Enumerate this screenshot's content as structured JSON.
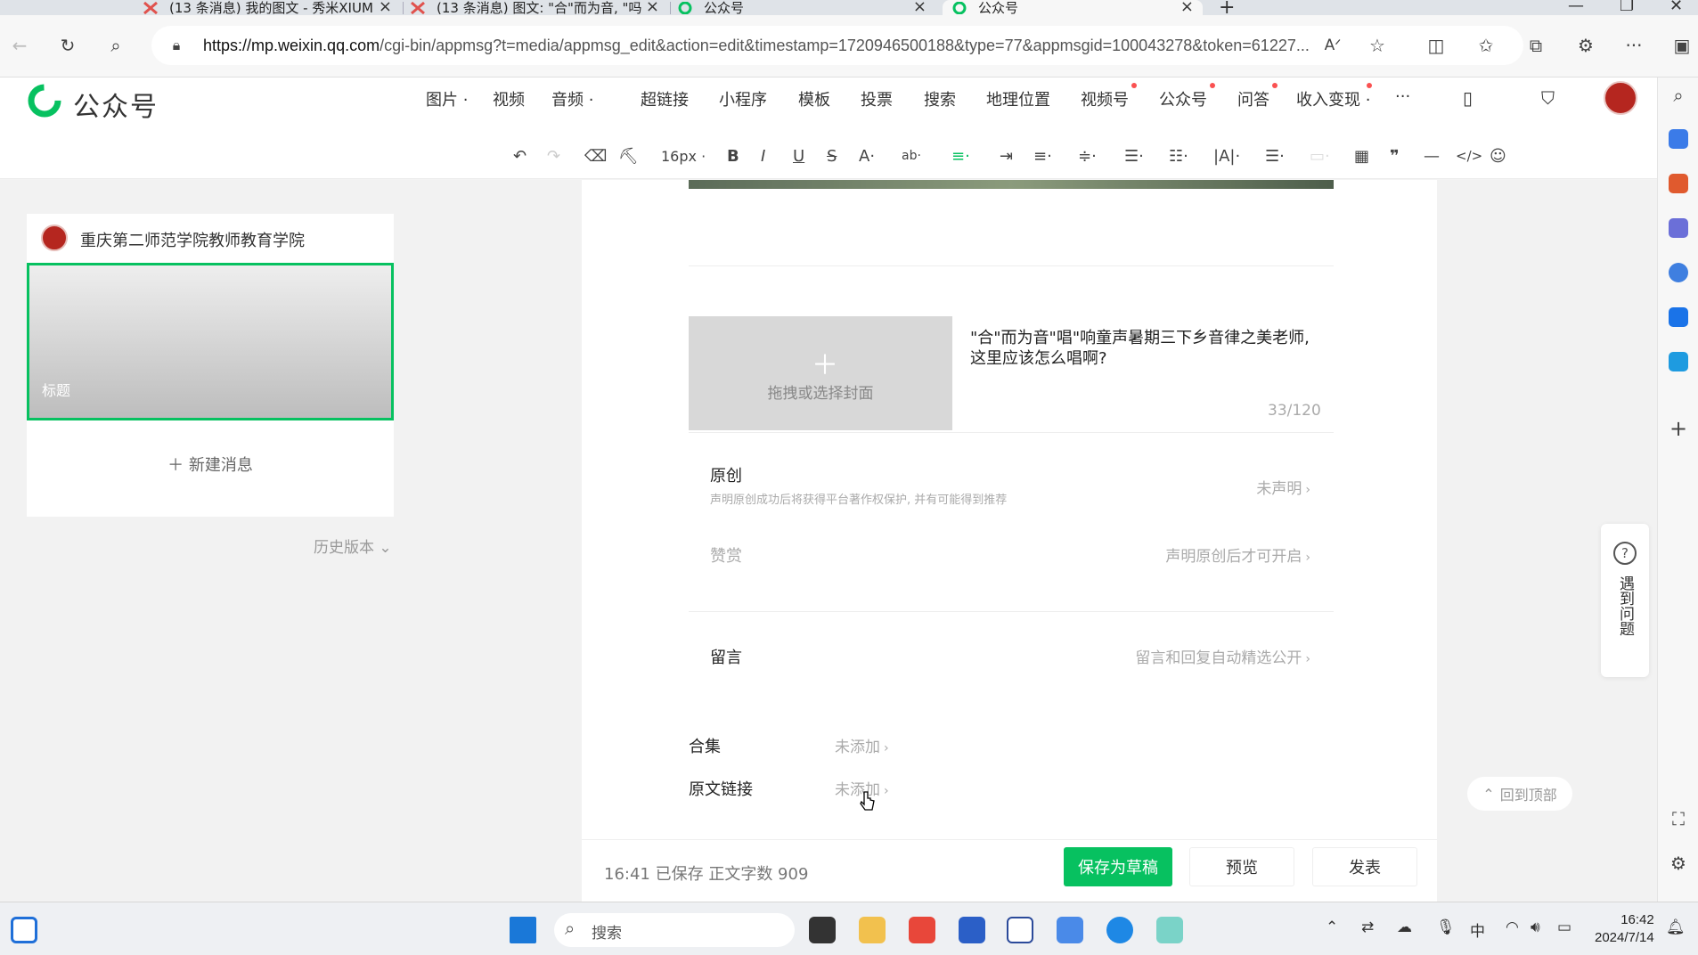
{
  "browser": {
    "tabs": [
      {
        "title": "(13 条消息) 我的图文 - 秀米XIUM"
      },
      {
        "title": "(13 条消息) 图文: \"合\"而为音, \"吗"
      },
      {
        "title": "公众号"
      },
      {
        "title": "公众号"
      }
    ],
    "url_host": "https://mp.weixin.qq.com",
    "url_path": "/cgi-bin/appmsg?t=media/appmsg_edit&action=edit&timestamp=1720946500188&type=77&appmsgid=100043278&token=61227..."
  },
  "header": {
    "brand": "公众号",
    "menu": [
      "图片",
      "视频",
      "音频",
      "超链接",
      "小程序",
      "模板",
      "投票",
      "搜索",
      "地理位置",
      "视频号",
      "公众号",
      "问答",
      "收入变现",
      "···"
    ]
  },
  "toolbar": {
    "font_size": "16px"
  },
  "left": {
    "account_name": "重庆第二师范学院教师教育学院",
    "thumb_label": "标题",
    "new_message": "新建消息",
    "history": "历史版本"
  },
  "editor": {
    "cover_hint": "拖拽或选择封面",
    "title": "\"合\"而为音\"唱\"响童声暑期三下乡音律之美老师, 这里应该怎么唱啊?",
    "title_count": "33/120",
    "original": {
      "label": "原创",
      "sub": "声明原创成功后将获得平台著作权保护, 并有可能得到推荐",
      "value": "未声明"
    },
    "reward": {
      "label": "赞赏",
      "value": "声明原创后才可开启"
    },
    "comment": {
      "label": "留言",
      "value": "留言和回复自动精选公开"
    },
    "collection": {
      "label": "合集",
      "value": "未添加"
    },
    "source_link": {
      "label": "原文链接",
      "value": "未添加"
    }
  },
  "bottom": {
    "saved_info": "16:41 已保存   正文字数  909",
    "save_draft": "保存为草稿",
    "preview": "预览",
    "publish": "发表"
  },
  "float": {
    "help": "遇到问题",
    "back_top": "回到顶部"
  },
  "taskbar": {
    "search": "搜索",
    "ime": "中",
    "time": "16:42",
    "date": "2024/7/14"
  },
  "colors": {
    "accent": "#07c160",
    "badge": "#fa5151",
    "logo_red": "#b5261f"
  }
}
